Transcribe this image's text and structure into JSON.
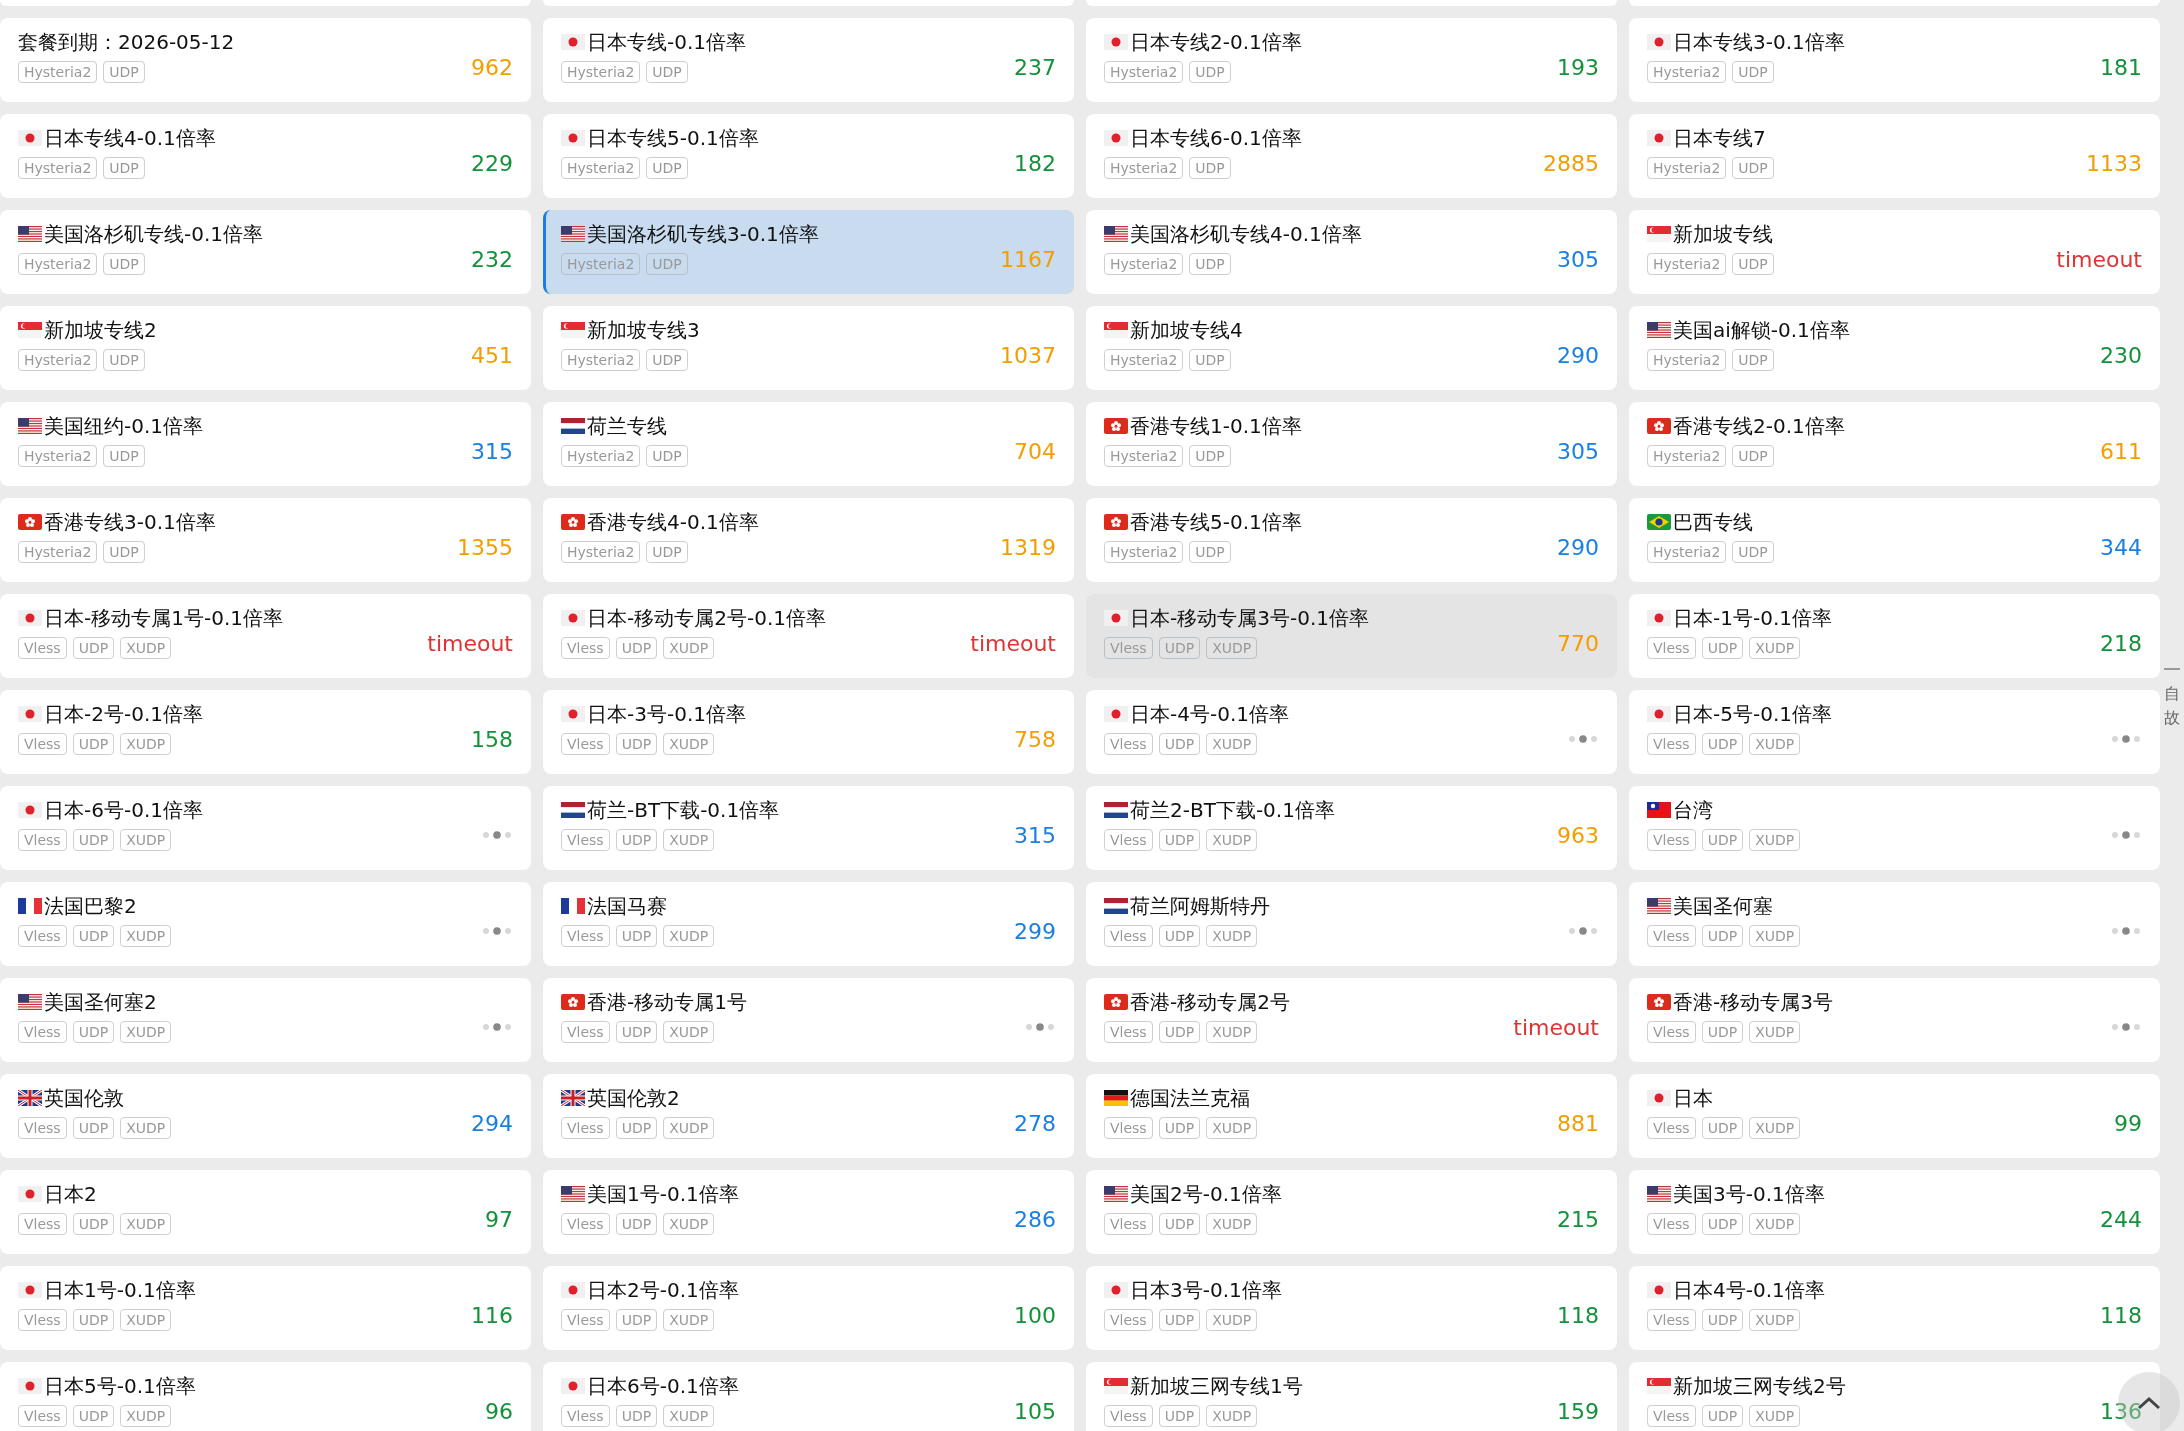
{
  "nodes": [
    {
      "name": "套餐到期：2026-05-12",
      "tags": [
        "Hysteria2",
        "UDP"
      ],
      "kind": "latency",
      "latency": "962",
      "color": "#f29d00",
      "selected": false,
      "hovered": false
    },
    {
      "name": "日本专线-0.1倍率",
      "flag": {
        "kind": "jp"
      },
      "tags": [
        "Hysteria2",
        "UDP"
      ],
      "kind": "latency",
      "latency": "237",
      "color": "#13913b",
      "selected": false,
      "hovered": false
    },
    {
      "name": "日本专线2-0.1倍率",
      "flag": {
        "kind": "jp"
      },
      "tags": [
        "Hysteria2",
        "UDP"
      ],
      "kind": "latency",
      "latency": "193",
      "color": "#13913b",
      "selected": false,
      "hovered": false
    },
    {
      "name": "日本专线3-0.1倍率",
      "flag": {
        "kind": "jp"
      },
      "tags": [
        "Hysteria2",
        "UDP"
      ],
      "kind": "latency",
      "latency": "181",
      "color": "#13913b",
      "selected": false,
      "hovered": false
    },
    {
      "name": "日本专线4-0.1倍率",
      "flag": {
        "kind": "jp"
      },
      "tags": [
        "Hysteria2",
        "UDP"
      ],
      "kind": "latency",
      "latency": "229",
      "color": "#13913b",
      "selected": false,
      "hovered": false
    },
    {
      "name": "日本专线5-0.1倍率",
      "flag": {
        "kind": "jp"
      },
      "tags": [
        "Hysteria2",
        "UDP"
      ],
      "kind": "latency",
      "latency": "182",
      "color": "#13913b",
      "selected": false,
      "hovered": false
    },
    {
      "name": "日本专线6-0.1倍率",
      "flag": {
        "kind": "jp"
      },
      "tags": [
        "Hysteria2",
        "UDP"
      ],
      "kind": "latency",
      "latency": "2885",
      "color": "#f29d00",
      "selected": false,
      "hovered": false
    },
    {
      "name": "日本专线7",
      "flag": {
        "kind": "jp"
      },
      "tags": [
        "Hysteria2",
        "UDP"
      ],
      "kind": "latency",
      "latency": "1133",
      "color": "#f29d00",
      "selected": false,
      "hovered": false
    },
    {
      "name": "美国洛杉矶专线-0.1倍率",
      "flag": {
        "kind": "us"
      },
      "tags": [
        "Hysteria2",
        "UDP"
      ],
      "kind": "latency",
      "latency": "232",
      "color": "#13913b",
      "selected": false,
      "hovered": false
    },
    {
      "name": "美国洛杉矶专线3-0.1倍率",
      "flag": {
        "kind": "us"
      },
      "tags": [
        "Hysteria2",
        "UDP"
      ],
      "kind": "latency",
      "latency": "1167",
      "color": "#f29d00",
      "selected": true,
      "hovered": false
    },
    {
      "name": "美国洛杉矶专线4-0.1倍率",
      "flag": {
        "kind": "us"
      },
      "tags": [
        "Hysteria2",
        "UDP"
      ],
      "kind": "latency",
      "latency": "305",
      "color": "#1a7fe0",
      "selected": false,
      "hovered": false
    },
    {
      "name": "新加坡专线",
      "flag": {
        "kind": "sg"
      },
      "tags": [
        "Hysteria2",
        "UDP"
      ],
      "kind": "latency",
      "latency": "timeout",
      "color": "#e03434",
      "selected": false,
      "hovered": false
    },
    {
      "name": "新加坡专线2",
      "flag": {
        "kind": "sg"
      },
      "tags": [
        "Hysteria2",
        "UDP"
      ],
      "kind": "latency",
      "latency": "451",
      "color": "#f29d00",
      "selected": false,
      "hovered": false
    },
    {
      "name": "新加坡专线3",
      "flag": {
        "kind": "sg"
      },
      "tags": [
        "Hysteria2",
        "UDP"
      ],
      "kind": "latency",
      "latency": "1037",
      "color": "#f29d00",
      "selected": false,
      "hovered": false
    },
    {
      "name": "新加坡专线4",
      "flag": {
        "kind": "sg"
      },
      "tags": [
        "Hysteria2",
        "UDP"
      ],
      "kind": "latency",
      "latency": "290",
      "color": "#1a7fe0",
      "selected": false,
      "hovered": false
    },
    {
      "name": "美国ai解锁-0.1倍率",
      "flag": {
        "kind": "us"
      },
      "tags": [
        "Hysteria2",
        "UDP"
      ],
      "kind": "latency",
      "latency": "230",
      "color": "#13913b",
      "selected": false,
      "hovered": false
    },
    {
      "name": "美国纽约-0.1倍率",
      "flag": {
        "kind": "us"
      },
      "tags": [
        "Hysteria2",
        "UDP"
      ],
      "kind": "latency",
      "latency": "315",
      "color": "#1a7fe0",
      "selected": false,
      "hovered": false
    },
    {
      "name": "荷兰专线",
      "flag": {
        "kind": "nl"
      },
      "tags": [
        "Hysteria2",
        "UDP"
      ],
      "kind": "latency",
      "latency": "704",
      "color": "#f29d00",
      "selected": false,
      "hovered": false
    },
    {
      "name": "香港专线1-0.1倍率",
      "flag": {
        "kind": "hk"
      },
      "tags": [
        "Hysteria2",
        "UDP"
      ],
      "kind": "latency",
      "latency": "305",
      "color": "#1a7fe0",
      "selected": false,
      "hovered": false
    },
    {
      "name": "香港专线2-0.1倍率",
      "flag": {
        "kind": "hk"
      },
      "tags": [
        "Hysteria2",
        "UDP"
      ],
      "kind": "latency",
      "latency": "611",
      "color": "#f29d00",
      "selected": false,
      "hovered": false
    },
    {
      "name": "香港专线3-0.1倍率",
      "flag": {
        "kind": "hk"
      },
      "tags": [
        "Hysteria2",
        "UDP"
      ],
      "kind": "latency",
      "latency": "1355",
      "color": "#f29d00",
      "selected": false,
      "hovered": false
    },
    {
      "name": "香港专线4-0.1倍率",
      "flag": {
        "kind": "hk"
      },
      "tags": [
        "Hysteria2",
        "UDP"
      ],
      "kind": "latency",
      "latency": "1319",
      "color": "#f29d00",
      "selected": false,
      "hovered": false
    },
    {
      "name": "香港专线5-0.1倍率",
      "flag": {
        "kind": "hk"
      },
      "tags": [
        "Hysteria2",
        "UDP"
      ],
      "kind": "latency",
      "latency": "290",
      "color": "#1a7fe0",
      "selected": false,
      "hovered": false
    },
    {
      "name": "巴西专线",
      "flag": {
        "kind": "br"
      },
      "tags": [
        "Hysteria2",
        "UDP"
      ],
      "kind": "latency",
      "latency": "344",
      "color": "#1a7fe0",
      "selected": false,
      "hovered": false
    },
    {
      "name": "日本-移动专属1号-0.1倍率",
      "flag": {
        "kind": "jp"
      },
      "tags": [
        "Vless",
        "UDP",
        "XUDP"
      ],
      "kind": "latency",
      "latency": "timeout",
      "color": "#e03434",
      "selected": false,
      "hovered": false
    },
    {
      "name": "日本-移动专属2号-0.1倍率",
      "flag": {
        "kind": "jp"
      },
      "tags": [
        "Vless",
        "UDP",
        "XUDP"
      ],
      "kind": "latency",
      "latency": "timeout",
      "color": "#e03434",
      "selected": false,
      "hovered": false
    },
    {
      "name": "日本-移动专属3号-0.1倍率",
      "flag": {
        "kind": "jp"
      },
      "tags": [
        "Vless",
        "UDP",
        "XUDP"
      ],
      "kind": "latency",
      "latency": "770",
      "color": "#f29d00",
      "selected": false,
      "hovered": true
    },
    {
      "name": "日本-1号-0.1倍率",
      "flag": {
        "kind": "jp"
      },
      "tags": [
        "Vless",
        "UDP",
        "XUDP"
      ],
      "kind": "latency",
      "latency": "218",
      "color": "#13913b",
      "selected": false,
      "hovered": false
    },
    {
      "name": "日本-2号-0.1倍率",
      "flag": {
        "kind": "jp"
      },
      "tags": [
        "Vless",
        "UDP",
        "XUDP"
      ],
      "kind": "latency",
      "latency": "158",
      "color": "#13913b",
      "selected": false,
      "hovered": false
    },
    {
      "name": "日本-3号-0.1倍率",
      "flag": {
        "kind": "jp"
      },
      "tags": [
        "Vless",
        "UDP",
        "XUDP"
      ],
      "kind": "latency",
      "latency": "758",
      "color": "#f29d00",
      "selected": false,
      "hovered": false
    },
    {
      "name": "日本-4号-0.1倍率",
      "flag": {
        "kind": "jp"
      },
      "tags": [
        "Vless",
        "UDP",
        "XUDP"
      ],
      "kind": "loading",
      "selected": false,
      "hovered": false
    },
    {
      "name": "日本-5号-0.1倍率",
      "flag": {
        "kind": "jp"
      },
      "tags": [
        "Vless",
        "UDP",
        "XUDP"
      ],
      "kind": "loading",
      "selected": false,
      "hovered": false
    },
    {
      "name": "日本-6号-0.1倍率",
      "flag": {
        "kind": "jp"
      },
      "tags": [
        "Vless",
        "UDP",
        "XUDP"
      ],
      "kind": "loading",
      "selected": false,
      "hovered": false
    },
    {
      "name": "荷兰-BT下载-0.1倍率",
      "flag": {
        "kind": "nl"
      },
      "tags": [
        "Vless",
        "UDP",
        "XUDP"
      ],
      "kind": "latency",
      "latency": "315",
      "color": "#1a7fe0",
      "selected": false,
      "hovered": false
    },
    {
      "name": "荷兰2-BT下载-0.1倍率",
      "flag": {
        "kind": "nl"
      },
      "tags": [
        "Vless",
        "UDP",
        "XUDP"
      ],
      "kind": "latency",
      "latency": "963",
      "color": "#f29d00",
      "selected": false,
      "hovered": false
    },
    {
      "name": "台湾",
      "flag": {
        "kind": "tw"
      },
      "tags": [
        "Vless",
        "UDP",
        "XUDP"
      ],
      "kind": "loading",
      "selected": false,
      "hovered": false
    },
    {
      "name": "法国巴黎2",
      "flag": {
        "kind": "fr"
      },
      "tags": [
        "Vless",
        "UDP",
        "XUDP"
      ],
      "kind": "loading",
      "selected": false,
      "hovered": false
    },
    {
      "name": "法国马赛",
      "flag": {
        "kind": "fr"
      },
      "tags": [
        "Vless",
        "UDP",
        "XUDP"
      ],
      "kind": "latency",
      "latency": "299",
      "color": "#1a7fe0",
      "selected": false,
      "hovered": false
    },
    {
      "name": "荷兰阿姆斯特丹",
      "flag": {
        "kind": "nl"
      },
      "tags": [
        "Vless",
        "UDP",
        "XUDP"
      ],
      "kind": "loading",
      "selected": false,
      "hovered": false
    },
    {
      "name": "美国圣何塞",
      "flag": {
        "kind": "us"
      },
      "tags": [
        "Vless",
        "UDP",
        "XUDP"
      ],
      "kind": "loading",
      "selected": false,
      "hovered": false
    },
    {
      "name": "美国圣何塞2",
      "flag": {
        "kind": "us"
      },
      "tags": [
        "Vless",
        "UDP",
        "XUDP"
      ],
      "kind": "loading",
      "selected": false,
      "hovered": false
    },
    {
      "name": "香港-移动专属1号",
      "flag": {
        "kind": "hk"
      },
      "tags": [
        "Vless",
        "UDP",
        "XUDP"
      ],
      "kind": "loading",
      "selected": false,
      "hovered": false
    },
    {
      "name": "香港-移动专属2号",
      "flag": {
        "kind": "hk"
      },
      "tags": [
        "Vless",
        "UDP",
        "XUDP"
      ],
      "kind": "latency",
      "latency": "timeout",
      "color": "#e03434",
      "selected": false,
      "hovered": false
    },
    {
      "name": "香港-移动专属3号",
      "flag": {
        "kind": "hk"
      },
      "tags": [
        "Vless",
        "UDP",
        "XUDP"
      ],
      "kind": "loading",
      "selected": false,
      "hovered": false
    },
    {
      "name": "英国伦敦",
      "flag": {
        "kind": "gb"
      },
      "tags": [
        "Vless",
        "UDP",
        "XUDP"
      ],
      "kind": "latency",
      "latency": "294",
      "color": "#1a7fe0",
      "selected": false,
      "hovered": false
    },
    {
      "name": "英国伦敦2",
      "flag": {
        "kind": "gb"
      },
      "tags": [
        "Vless",
        "UDP",
        "XUDP"
      ],
      "kind": "latency",
      "latency": "278",
      "color": "#1a7fe0",
      "selected": false,
      "hovered": false
    },
    {
      "name": "德国法兰克福",
      "flag": {
        "kind": "de"
      },
      "tags": [
        "Vless",
        "UDP",
        "XUDP"
      ],
      "kind": "latency",
      "latency": "881",
      "color": "#f29d00",
      "selected": false,
      "hovered": false
    },
    {
      "name": "日本",
      "flag": {
        "kind": "jp"
      },
      "tags": [
        "Vless",
        "UDP",
        "XUDP"
      ],
      "kind": "latency",
      "latency": "99",
      "color": "#13913b",
      "selected": false,
      "hovered": false
    },
    {
      "name": "日本2",
      "flag": {
        "kind": "jp"
      },
      "tags": [
        "Vless",
        "UDP",
        "XUDP"
      ],
      "kind": "latency",
      "latency": "97",
      "color": "#13913b",
      "selected": false,
      "hovered": false
    },
    {
      "name": "美国1号-0.1倍率",
      "flag": {
        "kind": "us"
      },
      "tags": [
        "Vless",
        "UDP",
        "XUDP"
      ],
      "kind": "latency",
      "latency": "286",
      "color": "#1a7fe0",
      "selected": false,
      "hovered": false
    },
    {
      "name": "美国2号-0.1倍率",
      "flag": {
        "kind": "us"
      },
      "tags": [
        "Vless",
        "UDP",
        "XUDP"
      ],
      "kind": "latency",
      "latency": "215",
      "color": "#13913b",
      "selected": false,
      "hovered": false
    },
    {
      "name": "美国3号-0.1倍率",
      "flag": {
        "kind": "us"
      },
      "tags": [
        "Vless",
        "UDP",
        "XUDP"
      ],
      "kind": "latency",
      "latency": "244",
      "color": "#13913b",
      "selected": false,
      "hovered": false
    },
    {
      "name": "日本1号-0.1倍率",
      "flag": {
        "kind": "jp"
      },
      "tags": [
        "Vless",
        "UDP",
        "XUDP"
      ],
      "kind": "latency",
      "latency": "116",
      "color": "#13913b",
      "selected": false,
      "hovered": false
    },
    {
      "name": "日本2号-0.1倍率",
      "flag": {
        "kind": "jp"
      },
      "tags": [
        "Vless",
        "UDP",
        "XUDP"
      ],
      "kind": "latency",
      "latency": "100",
      "color": "#13913b",
      "selected": false,
      "hovered": false
    },
    {
      "name": "日本3号-0.1倍率",
      "flag": {
        "kind": "jp"
      },
      "tags": [
        "Vless",
        "UDP",
        "XUDP"
      ],
      "kind": "latency",
      "latency": "118",
      "color": "#13913b",
      "selected": false,
      "hovered": false
    },
    {
      "name": "日本4号-0.1倍率",
      "flag": {
        "kind": "jp"
      },
      "tags": [
        "Vless",
        "UDP",
        "XUDP"
      ],
      "kind": "latency",
      "latency": "118",
      "color": "#13913b",
      "selected": false,
      "hovered": false
    },
    {
      "name": "日本5号-0.1倍率",
      "flag": {
        "kind": "jp"
      },
      "tags": [
        "Vless",
        "UDP",
        "XUDP"
      ],
      "kind": "latency",
      "latency": "96",
      "color": "#13913b",
      "selected": false,
      "hovered": false
    },
    {
      "name": "日本6号-0.1倍率",
      "flag": {
        "kind": "jp"
      },
      "tags": [
        "Vless",
        "UDP",
        "XUDP"
      ],
      "kind": "latency",
      "latency": "105",
      "color": "#13913b",
      "selected": false,
      "hovered": false
    },
    {
      "name": "新加坡三网专线1号",
      "flag": {
        "kind": "sg"
      },
      "tags": [
        "Vless",
        "UDP",
        "XUDP"
      ],
      "kind": "latency",
      "latency": "159",
      "color": "#13913b",
      "selected": false,
      "hovered": false
    },
    {
      "name": "新加坡三网专线2号",
      "flag": {
        "kind": "sg"
      },
      "tags": [
        "Vless",
        "UDP",
        "XUDP"
      ],
      "kind": "latency",
      "latency": "136",
      "color": "#13913b",
      "selected": false,
      "hovered": false
    }
  ],
  "side_panel": {
    "label": "自故"
  }
}
